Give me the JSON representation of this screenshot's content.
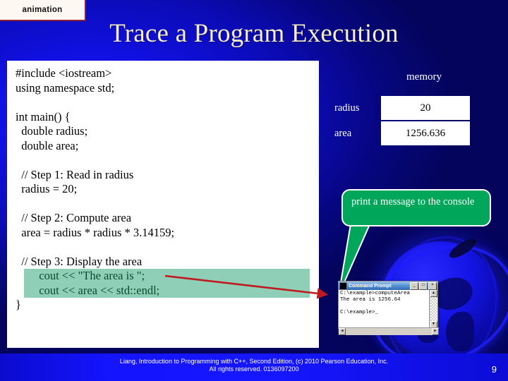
{
  "tab": {
    "label": "animation"
  },
  "title": "Trace a Program Execution",
  "code": {
    "lines": [
      {
        "text": "#include <iostream>",
        "highlight": false
      },
      {
        "text": "using namespace std;",
        "highlight": false
      },
      {
        "text": "",
        "highlight": false
      },
      {
        "text": "int main() {",
        "highlight": false
      },
      {
        "text": "  double radius;",
        "highlight": false
      },
      {
        "text": "  double area;",
        "highlight": false
      },
      {
        "text": "",
        "highlight": false
      },
      {
        "text": "  // Step 1: Read in radius",
        "highlight": false
      },
      {
        "text": "  radius = 20;",
        "highlight": false
      },
      {
        "text": "",
        "highlight": false
      },
      {
        "text": "  // Step 2: Compute area",
        "highlight": false
      },
      {
        "text": "  area = radius * radius * 3.14159;",
        "highlight": false
      },
      {
        "text": "",
        "highlight": false
      },
      {
        "text": "  // Step 3: Display the area",
        "highlight": false
      },
      {
        "text": "  cout << \"The area is \";",
        "highlight": true
      },
      {
        "text": "  cout << area << std::endl;",
        "highlight": true
      },
      {
        "text": "}",
        "highlight": false
      }
    ]
  },
  "memory": {
    "label": "memory",
    "rows": [
      {
        "name": "radius",
        "value": "20"
      },
      {
        "name": "area",
        "value": "1256.636"
      }
    ]
  },
  "callout": {
    "text": "print a message to the console"
  },
  "console": {
    "title": "Command Prompt",
    "minimize": "_",
    "maximize": "□",
    "close": "×",
    "scroll_up": "▲",
    "scroll_down": "▼",
    "scroll_left": "◄",
    "scroll_right": "►",
    "lines": [
      "C:\\example>computeArea",
      "The area is 1256.64",
      "",
      "C:\\example>_"
    ]
  },
  "footer": {
    "line1": "Liang, Introduction to Programming with C++, Second Edition, (c) 2010 Pearson Education, Inc.",
    "line2": "All rights reserved. 0136097200",
    "page": "9"
  },
  "colors": {
    "slide_bg": "#0a0acd",
    "title_text": "#f5eec8",
    "code_bg": "#ffffff",
    "highlight_bg": "#8fcfb8",
    "highlight_text": "#0c4a2e",
    "bubble_bg": "#00a65a",
    "arrow": "#c0191f",
    "tab_border": "#8d2030"
  }
}
